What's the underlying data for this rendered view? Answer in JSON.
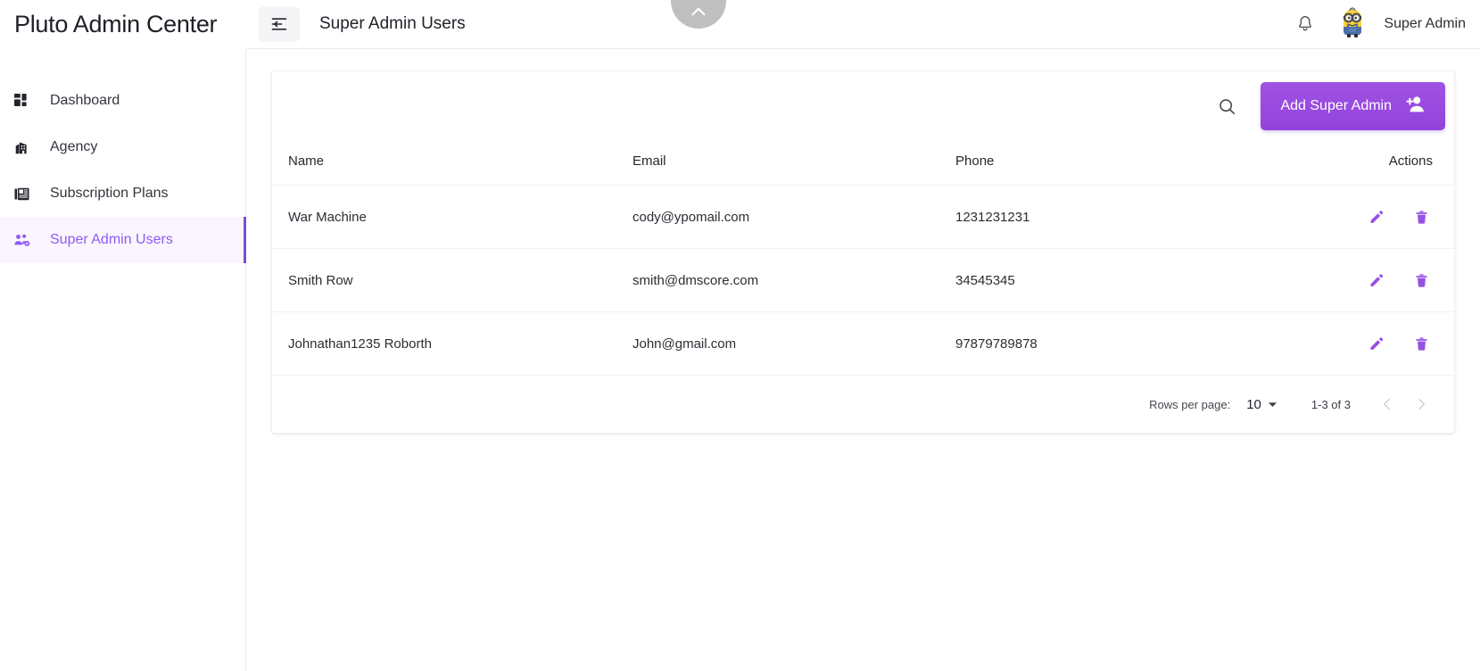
{
  "brand": {
    "title": "Pluto Admin Center"
  },
  "topbar": {
    "menu_toggle_label": "menu-toggle",
    "page_title": "Super Admin Users",
    "user_name": "Super Admin",
    "notifications_label": "Notifications",
    "scroll_top_label": "Scroll to top"
  },
  "sidebar": {
    "items": [
      {
        "label": "Dashboard",
        "icon": "dashboard-icon",
        "active": false
      },
      {
        "label": "Agency",
        "icon": "building-icon",
        "active": false
      },
      {
        "label": "Subscription Plans",
        "icon": "newspaper-icon",
        "active": false
      },
      {
        "label": "Super Admin Users",
        "icon": "users-group-icon",
        "active": true
      }
    ]
  },
  "toolbar": {
    "search_label": "Search",
    "add_button_label": "Add Super Admin"
  },
  "table": {
    "columns": [
      "Name",
      "Email",
      "Phone",
      "Actions"
    ],
    "rows": [
      {
        "name": "War Machine",
        "email": "cody@ypomail.com",
        "phone": "1231231231"
      },
      {
        "name": "Smith Row",
        "email": "smith@dmscore.com",
        "phone": "34545345"
      },
      {
        "name": "Johnathan1235 Roborth",
        "email": "John@gmail.com",
        "phone": "97879789878"
      }
    ],
    "row_actions": {
      "edit_label": "Edit",
      "delete_label": "Delete"
    }
  },
  "pagination": {
    "rows_per_page_label": "Rows per page:",
    "rows_per_page_value": "10",
    "range_label": "1-3 of 3",
    "prev_label": "Previous page",
    "next_label": "Next page"
  },
  "colors": {
    "accent": "#9c4ee0",
    "accent_soft": "#faf5ff",
    "active_bar": "#7c4dd6",
    "icon_purple": "#9651e3",
    "fab_gray": "#bfbfbf"
  }
}
